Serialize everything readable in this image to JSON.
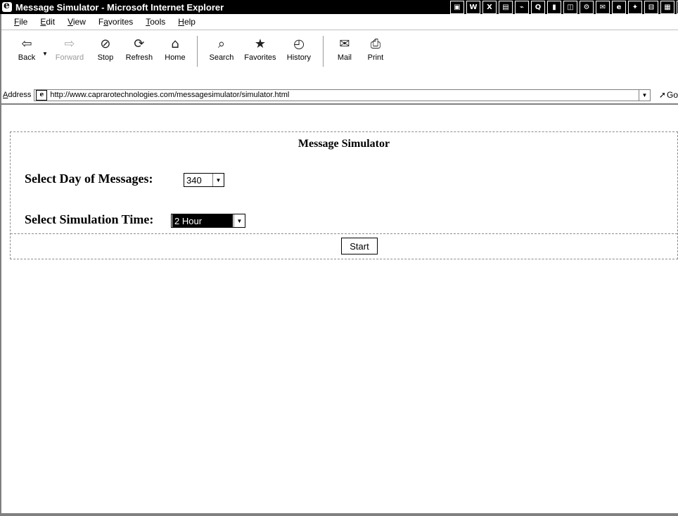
{
  "window": {
    "title": "Message Simulator - Microsoft Internet Explorer"
  },
  "titlebar_icons": [
    {
      "name": "window-icon",
      "glyph": "▣"
    },
    {
      "name": "word-icon",
      "glyph": "W"
    },
    {
      "name": "excel-icon",
      "glyph": "X"
    },
    {
      "name": "powerpoint-icon",
      "glyph": "▤"
    },
    {
      "name": "access-icon",
      "glyph": "⌁"
    },
    {
      "name": "find-icon",
      "glyph": "Q"
    },
    {
      "name": "binder-icon",
      "glyph": "▮"
    },
    {
      "name": "bookshelf-icon",
      "glyph": "◫"
    },
    {
      "name": "tools-icon",
      "glyph": "⚙"
    },
    {
      "name": "outlook-icon",
      "glyph": "✉"
    },
    {
      "name": "ie-icon",
      "glyph": "e"
    },
    {
      "name": "network-icon",
      "glyph": "✦"
    },
    {
      "name": "briefcase-icon",
      "glyph": "⊟"
    },
    {
      "name": "calendar-icon",
      "glyph": "▦"
    },
    {
      "name": "settings-icon",
      "glyph": "§"
    },
    {
      "name": "folder-icon",
      "glyph": "⊡"
    }
  ],
  "menu": {
    "file": {
      "acc": "F",
      "rest": "ile"
    },
    "edit": {
      "acc": "E",
      "rest": "dit"
    },
    "view": {
      "acc": "V",
      "rest": "iew"
    },
    "favorites": {
      "pre": "F",
      "acc": "a",
      "rest": "vorites"
    },
    "tools": {
      "acc": "T",
      "rest": "ools"
    },
    "help": {
      "acc": "H",
      "rest": "elp"
    }
  },
  "toolbar": {
    "back": {
      "label": "Back",
      "icon": "back-arrow-icon"
    },
    "forward": {
      "label": "Forward",
      "icon": "forward-arrow-icon"
    },
    "stop": {
      "label": "Stop",
      "icon": "stop-icon"
    },
    "refresh": {
      "label": "Refresh",
      "icon": "refresh-icon"
    },
    "home": {
      "label": "Home",
      "icon": "home-icon"
    },
    "search": {
      "label": "Search",
      "icon": "search-icon"
    },
    "favorites": {
      "label": "Favorites",
      "icon": "favorites-icon"
    },
    "history": {
      "label": "History",
      "icon": "history-icon"
    },
    "mail": {
      "label": "Mail",
      "icon": "mail-icon"
    },
    "print": {
      "label": "Print",
      "icon": "print-icon"
    }
  },
  "address": {
    "label_acc": "A",
    "label_rest": "ddress",
    "url": "http://www.caprarotechnologies.com/messagesimulator/simulator.html",
    "go_label": "Go"
  },
  "page": {
    "title": "Message Simulator",
    "day_label": "Select Day of Messages:",
    "day_value": "340",
    "time_label": "Select Simulation Time:",
    "time_value": "2 Hour",
    "start_label": "Start"
  }
}
